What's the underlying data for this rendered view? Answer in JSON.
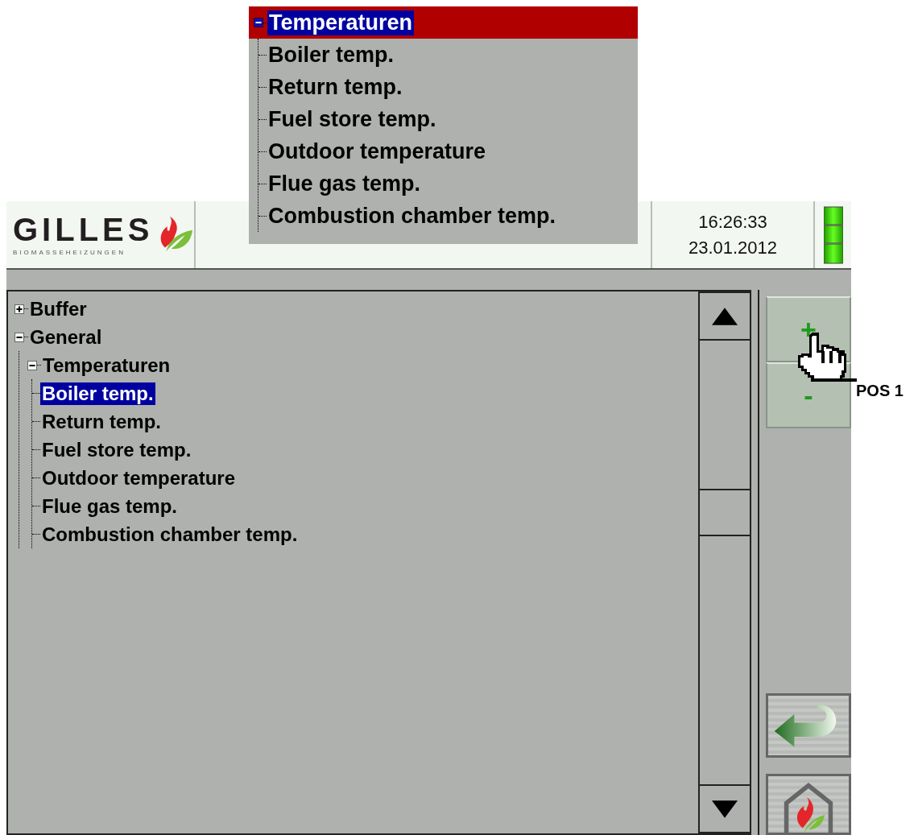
{
  "inset": {
    "tree": [
      {
        "label": "Temperaturen",
        "expanded": true,
        "selected": true,
        "children": [
          {
            "label": "Boiler temp.",
            "selected": false
          },
          {
            "label": "Return temp.",
            "selected": false
          },
          {
            "label": "Fuel store temp.",
            "selected": false
          },
          {
            "label": "Outdoor temperature",
            "selected": false
          },
          {
            "label": "Flue gas temp.",
            "selected": false
          },
          {
            "label": "Combustion chamber temp.",
            "selected": false
          }
        ]
      }
    ]
  },
  "header": {
    "logo": {
      "name": "GILLES",
      "tagline": "BIOMASSEHEIZUNGEN"
    },
    "time": "16:26:33",
    "date": "23.01.2012"
  },
  "tree": [
    {
      "label": "Buffer",
      "expanded": false,
      "selected": false
    },
    {
      "label": "General",
      "expanded": true,
      "selected": false,
      "children": [
        {
          "label": "Temperaturen",
          "expanded": true,
          "selected": false,
          "children": [
            {
              "label": "Boiler temp.",
              "selected": true
            },
            {
              "label": "Return temp.",
              "selected": false
            },
            {
              "label": "Fuel store temp.",
              "selected": false
            },
            {
              "label": "Outdoor temperature",
              "selected": false
            },
            {
              "label": "Flue gas temp.",
              "selected": false
            },
            {
              "label": "Combustion chamber temp.",
              "selected": false
            }
          ]
        }
      ]
    }
  ],
  "side_buttons": {
    "plus": "+",
    "minus": "-"
  },
  "annotation": {
    "label": "POS 1"
  }
}
